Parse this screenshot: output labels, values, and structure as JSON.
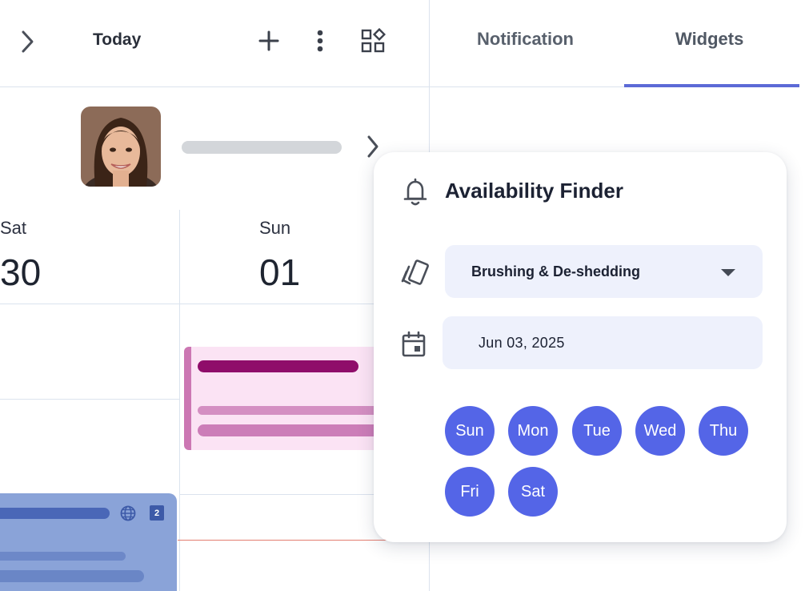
{
  "calendar": {
    "nav": {
      "next_icon": "chevron-right-icon",
      "today_label": "Today",
      "add_icon": "plus-icon",
      "more_icon": "more-vertical-icon",
      "widgets_icon": "apps-grid-icon"
    },
    "staff": {
      "avatar_icon": "avatar",
      "next_icon": "chevron-right-icon"
    },
    "days": [
      {
        "name": "Sat",
        "number": "30"
      },
      {
        "name": "Sun",
        "number": "01"
      }
    ],
    "blue_event": {
      "globe_icon": "globe-icon",
      "badge": "2"
    }
  },
  "tabs": [
    {
      "label": "Notification",
      "active": false
    },
    {
      "label": "Widgets",
      "active": true
    }
  ],
  "widget": {
    "title": "Availability Finder",
    "bell_icon": "bell-icon",
    "service_icon": "tag-icon",
    "service_value": "Brushing & De-shedding",
    "calendar_icon": "calendar-icon",
    "date_value": "Jun 03, 2025",
    "weekdays": [
      "Sun",
      "Mon",
      "Tue",
      "Wed",
      "Thu",
      "Fri",
      "Sat"
    ]
  },
  "colors": {
    "accent": "#5465e7",
    "tab_underline": "#5c6ad6",
    "pink_event": "#fbe3f4",
    "blue_event": "#8aa3d8"
  }
}
